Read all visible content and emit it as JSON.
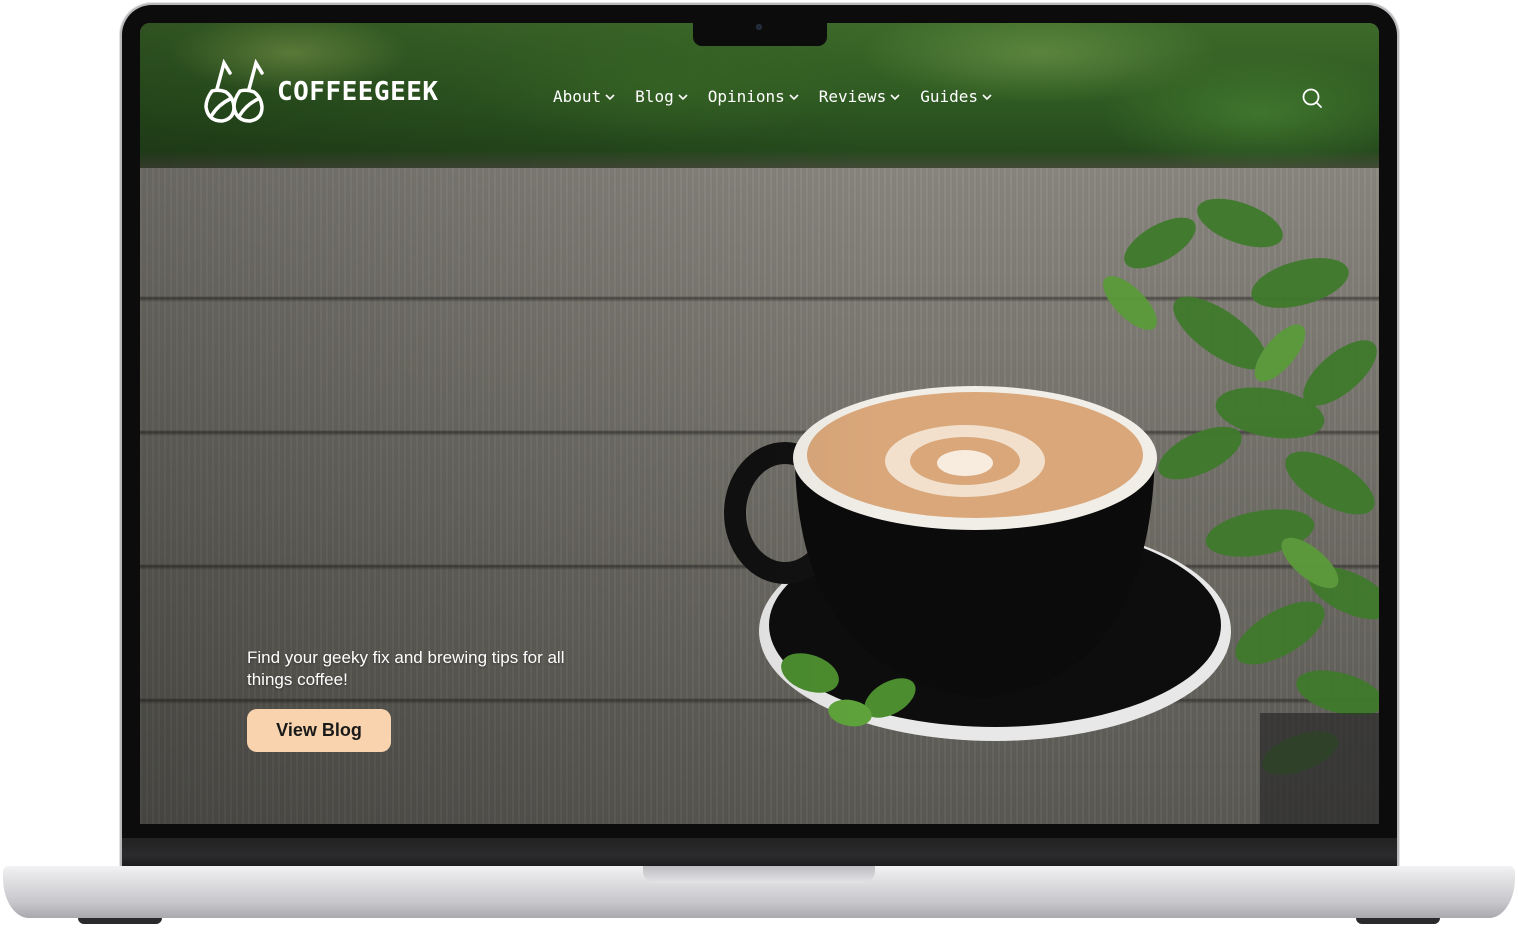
{
  "site": {
    "name": "COFFEEGEEK"
  },
  "nav": {
    "items": [
      {
        "label": "About"
      },
      {
        "label": "Blog"
      },
      {
        "label": "Opinions"
      },
      {
        "label": "Reviews"
      },
      {
        "label": "Guides"
      }
    ]
  },
  "hero": {
    "tagline": "Find your geeky fix and brewing tips for all things coffee!",
    "cta_label": "View Blog"
  },
  "icons": {
    "logo": "coffee-beans-logo-icon",
    "dropdown": "chevron-down-icon",
    "search": "search-icon"
  },
  "colors": {
    "cta_background": "#f9d3ad",
    "header_text": "#ffffff"
  }
}
